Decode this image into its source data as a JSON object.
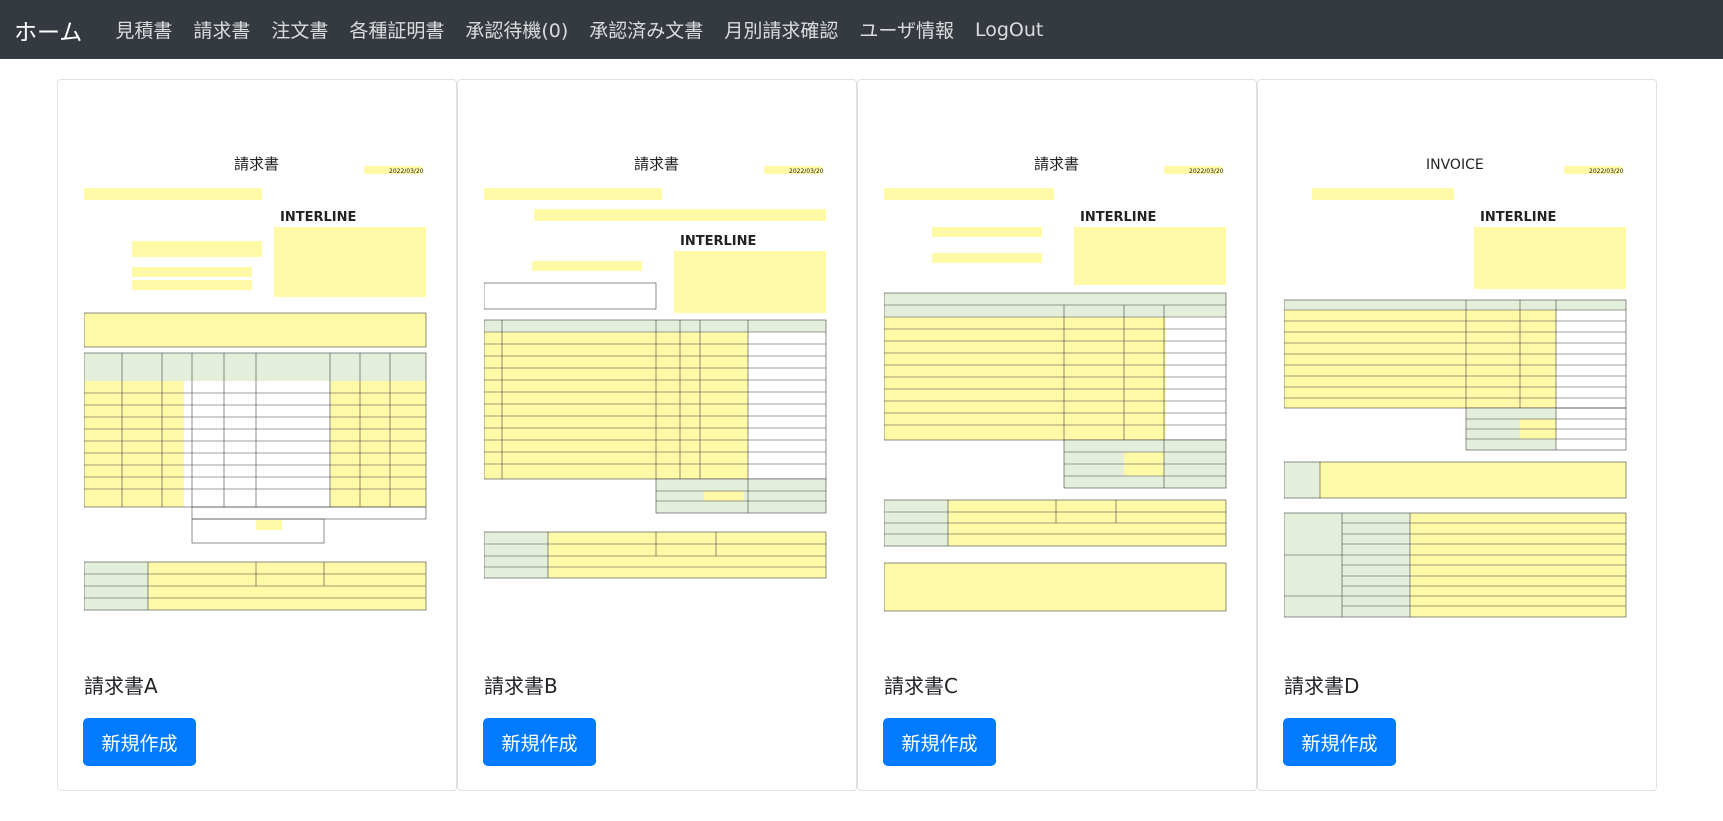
{
  "nav": {
    "brand": "ホーム",
    "items": [
      "見積書",
      "請求書",
      "注文書",
      "各種証明書",
      "承認待機(0)",
      "承認済み文書",
      "月別請求確認",
      "ユーザ情報",
      "LogOut"
    ]
  },
  "cards": [
    {
      "title": "請求書A",
      "button": "新規作成",
      "doc_title": "請求書",
      "logo": "INTERLINE",
      "date": "2022/03/20"
    },
    {
      "title": "請求書B",
      "button": "新規作成",
      "doc_title": "請求書",
      "logo": "INTERLINE",
      "date": "2022/03/20"
    },
    {
      "title": "請求書C",
      "button": "新規作成",
      "doc_title": "請求書",
      "logo": "INTERLINE",
      "date": "2022/03/20"
    },
    {
      "title": "請求書D",
      "button": "新規作成",
      "doc_title": "INVOICE",
      "logo": "INTERLINE",
      "date": "2022/03/20"
    }
  ],
  "colors": {
    "navbar": "#343a40",
    "button": "#007bff",
    "highlight": "#fff9a8",
    "header_fill": "#e3efdb"
  }
}
